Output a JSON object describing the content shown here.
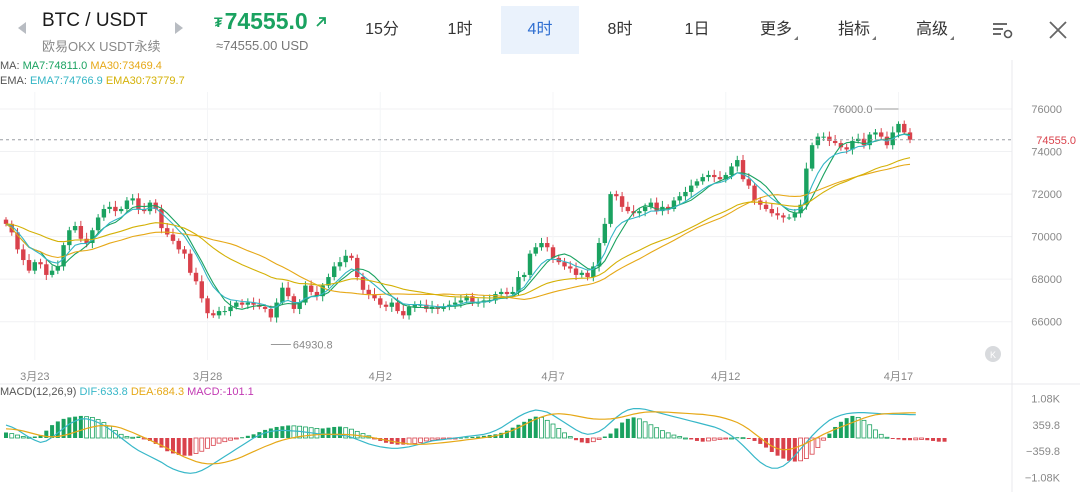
{
  "header": {
    "pair": "BTC / USDT",
    "venue": "欧易OKX USDT永续",
    "currency_symbol": "₮",
    "price": "74555.0",
    "usd_price": "≈74555.00 USD",
    "tabs": [
      "15分",
      "1时",
      "4时",
      "8时",
      "1日"
    ],
    "active_tab": "4时",
    "menus": [
      "更多",
      "指标",
      "高级"
    ],
    "icons": [
      "chevron-left-icon",
      "chevron-right-icon",
      "arrow-up-right-icon",
      "chart-settings-icon",
      "close-icon"
    ]
  },
  "indicators": {
    "ma": {
      "label": "MA:",
      "ma7": "MA7:74811.0",
      "ma30": "MA30:73469.4"
    },
    "ema": {
      "label": "EMA:",
      "ema7": "EMA7:74766.9",
      "ema30": "EMA30:73779.7"
    },
    "macd": {
      "label": "MACD(12,26,9)",
      "dif": "DIF:633.8",
      "dea": "DEA:684.3",
      "macd": "MACD:-101.1"
    }
  },
  "colors": {
    "up": "#1aa260",
    "down": "#d9414b",
    "ma7": "#1aa260",
    "ma30": "#e6a817",
    "ema7": "#33b5c5",
    "ema30": "#d4b106",
    "dif": "#37b7c8",
    "dea": "#e6a817",
    "macd_label": "#c239b3",
    "accent": "#2f6fd1"
  },
  "chart_data": [
    {
      "type": "candlestick",
      "timeframe": "4时",
      "y_ticks": [
        "76000",
        "74000",
        "72000",
        "70000",
        "68000",
        "66000"
      ],
      "ylim": [
        64200,
        76800
      ],
      "x_labels": [
        "3月23",
        "3月28",
        "4月2",
        "4月7",
        "4月12",
        "4月17"
      ],
      "last_price_label": "74555.0",
      "last_price": 74555.0,
      "high_annotation": {
        "label": "76000.0",
        "value": 76000.0
      },
      "low_annotation": {
        "label": "64930.8",
        "value": 64930.8
      },
      "closes": [
        70600,
        70200,
        69400,
        68900,
        68400,
        68800,
        68700,
        68200,
        68400,
        68600,
        69600,
        70300,
        70500,
        69900,
        69700,
        70300,
        70900,
        71300,
        71400,
        71200,
        71300,
        71700,
        71800,
        71300,
        71200,
        71600,
        71300,
        70400,
        70100,
        69800,
        69400,
        69200,
        68300,
        67900,
        67100,
        66400,
        66300,
        66500,
        66500,
        66700,
        66900,
        66800,
        66900,
        66800,
        66700,
        66600,
        66200,
        66900,
        67600,
        67200,
        66600,
        66900,
        67700,
        67400,
        67200,
        67700,
        68100,
        68600,
        68800,
        69100,
        69000,
        68100,
        67500,
        67300,
        67100,
        66800,
        66700,
        66900,
        66500,
        66300,
        66700,
        66800,
        66800,
        66600,
        66700,
        66600,
        66700,
        66800,
        66900,
        67000,
        67200,
        66900,
        66900,
        67000,
        67000,
        67300,
        67400,
        67300,
        67400,
        68100,
        68200,
        69200,
        69500,
        69700,
        69500,
        69000,
        68800,
        68600,
        68500,
        68200,
        68300,
        68100,
        68600,
        69700,
        70600,
        72000,
        71900,
        71400,
        71200,
        71100,
        71200,
        71400,
        71600,
        71200,
        71400,
        71300,
        71700,
        71900,
        72100,
        72400,
        72600,
        72800,
        72900,
        72800,
        72700,
        72900,
        73300,
        73600,
        72700,
        72400,
        71700,
        71500,
        71300,
        71100,
        71000,
        70900,
        70900,
        71100,
        71500,
        73200,
        74300,
        74700,
        74700,
        74500,
        74400,
        74200,
        74100,
        74500,
        74600,
        74300,
        74800,
        74900,
        74700,
        74300,
        74900,
        75300,
        74900,
        74555
      ]
    },
    {
      "type": "macd",
      "y_ticks": [
        "1.08K",
        "359.8",
        "−359.8",
        "−1.08K"
      ],
      "ylim": [
        -1250,
        1250
      ],
      "histogram": [
        150,
        120,
        80,
        40,
        20,
        40,
        80,
        200,
        350,
        450,
        520,
        560,
        580,
        600,
        580,
        560,
        500,
        420,
        320,
        200,
        100,
        40,
        20,
        40,
        -20,
        -80,
        -160,
        -260,
        -360,
        -420,
        -460,
        -480,
        -480,
        -420,
        -360,
        -280,
        -200,
        -140,
        -100,
        -60,
        -20,
        20,
        60,
        100,
        160,
        220,
        260,
        300,
        320,
        340,
        330,
        320,
        300,
        280,
        260,
        260,
        280,
        300,
        310,
        280,
        240,
        180,
        120,
        60,
        -20,
        -80,
        -130,
        -160,
        -180,
        -180,
        -170,
        -150,
        -120,
        -80,
        -60,
        -40,
        -30,
        -20,
        -10,
        10,
        20,
        30,
        40,
        60,
        80,
        100,
        140,
        200,
        280,
        360,
        440,
        520,
        580,
        560,
        480,
        380,
        260,
        140,
        40,
        -60,
        -120,
        -140,
        -100,
        -40,
        40,
        120,
        260,
        420,
        520,
        560,
        520,
        440,
        360,
        280,
        200,
        140,
        80,
        40,
        0,
        -40,
        -80,
        -100,
        -80,
        -60,
        -40,
        -20,
        0,
        20,
        10,
        -20,
        -80,
        -160,
        -260,
        -380,
        -480,
        -560,
        -620,
        -640,
        -620,
        -560,
        -440,
        -260,
        -60,
        120,
        300,
        440,
        540,
        600,
        560,
        480,
        360,
        220,
        100,
        20,
        -20,
        -40,
        -60,
        -60,
        -50,
        -40,
        -60,
        -80,
        -100,
        -101.1
      ],
      "dif": [
        350,
        300,
        220,
        120,
        20,
        -60,
        -120,
        -80,
        20,
        140,
        260,
        380,
        460,
        520,
        520,
        480,
        420,
        340,
        240,
        120,
        0,
        -120,
        -240,
        -340,
        -420,
        -500,
        -580,
        -660,
        -760,
        -840,
        -900,
        -940,
        -960,
        -940,
        -880,
        -800,
        -700,
        -600,
        -500,
        -400,
        -300,
        -200,
        -100,
        0,
        80,
        140,
        180,
        200,
        210,
        200,
        190,
        180,
        160,
        140,
        120,
        110,
        100,
        90,
        80,
        60,
        20,
        -40,
        -100,
        -160,
        -200,
        -240,
        -260,
        -280,
        -280,
        -260,
        -240,
        -200,
        -160,
        -120,
        -80,
        -60,
        -40,
        -20,
        0,
        20,
        40,
        60,
        80,
        100,
        140,
        200,
        280,
        380,
        480,
        580,
        660,
        720,
        760,
        740,
        700,
        620,
        520,
        420,
        320,
        220,
        140,
        100,
        120,
        180,
        280,
        420,
        560,
        680,
        760,
        800,
        800,
        780,
        740,
        700,
        660,
        620,
        580,
        540,
        500,
        460,
        420,
        380,
        340,
        300,
        240,
        160,
        60,
        -60,
        -200,
        -360,
        -520,
        -660,
        -760,
        -820,
        -820,
        -760,
        -640,
        -480,
        -300,
        -120,
        60,
        220,
        360,
        480,
        560,
        620,
        660,
        680,
        690,
        690,
        680,
        670,
        660,
        655,
        650,
        645,
        640,
        636,
        633.8
      ],
      "dea": [
        250,
        240,
        220,
        190,
        150,
        110,
        70,
        40,
        30,
        40,
        70,
        110,
        160,
        210,
        260,
        300,
        330,
        340,
        330,
        310,
        270,
        210,
        150,
        80,
        10,
        -60,
        -130,
        -200,
        -280,
        -360,
        -440,
        -520,
        -580,
        -640,
        -680,
        -700,
        -700,
        -690,
        -660,
        -620,
        -570,
        -510,
        -440,
        -370,
        -300,
        -230,
        -170,
        -110,
        -60,
        -20,
        10,
        40,
        60,
        80,
        90,
        100,
        100,
        100,
        100,
        95,
        85,
        70,
        50,
        30,
        0,
        -30,
        -60,
        -90,
        -120,
        -140,
        -160,
        -170,
        -170,
        -165,
        -155,
        -140,
        -125,
        -110,
        -90,
        -70,
        -50,
        -30,
        -10,
        10,
        30,
        60,
        100,
        150,
        210,
        280,
        360,
        440,
        510,
        570,
        620,
        650,
        660,
        650,
        630,
        600,
        570,
        540,
        520,
        510,
        510,
        520,
        540,
        570,
        610,
        650,
        680,
        700,
        710,
        710,
        705,
        700,
        690,
        680,
        670,
        660,
        650,
        640,
        620,
        600,
        570,
        530,
        480,
        420,
        340,
        240,
        120,
        0,
        -120,
        -220,
        -290,
        -320,
        -310,
        -270,
        -210,
        -140,
        -60,
        20,
        100,
        170,
        240,
        300,
        360,
        420,
        480,
        540,
        590,
        630,
        650,
        660,
        670,
        675,
        680,
        684,
        684.3
      ]
    }
  ]
}
